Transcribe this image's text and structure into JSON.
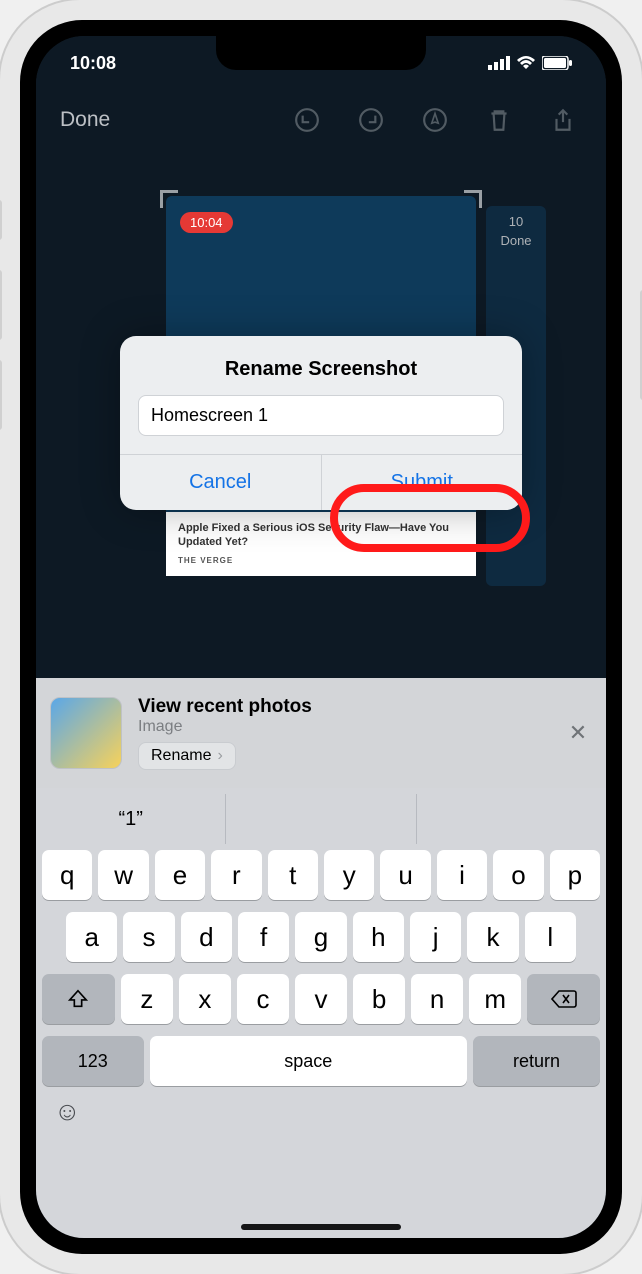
{
  "status": {
    "time": "10:08"
  },
  "toolbar": {
    "done": "Done"
  },
  "preview": {
    "time_pill": "10:04",
    "article": "Apple Fixed a Serious iOS Security Flaw—Have You Updated Yet?",
    "source": "THE VERGE",
    "second": {
      "time": "10",
      "done": "Done"
    }
  },
  "dialog": {
    "title": "Rename Screenshot",
    "value": "Homescreen 1",
    "cancel": "Cancel",
    "submit": "Submit"
  },
  "siri": {
    "title": "View recent photos",
    "subtitle": "Image",
    "chip": "Rename"
  },
  "keyboard": {
    "pred1": "“1”",
    "row1": [
      "q",
      "w",
      "e",
      "r",
      "t",
      "y",
      "u",
      "i",
      "o",
      "p"
    ],
    "row2": [
      "a",
      "s",
      "d",
      "f",
      "g",
      "h",
      "j",
      "k",
      "l"
    ],
    "row3": [
      "z",
      "x",
      "c",
      "v",
      "b",
      "n",
      "m"
    ],
    "key123": "123",
    "space": "space",
    "return": "return"
  }
}
